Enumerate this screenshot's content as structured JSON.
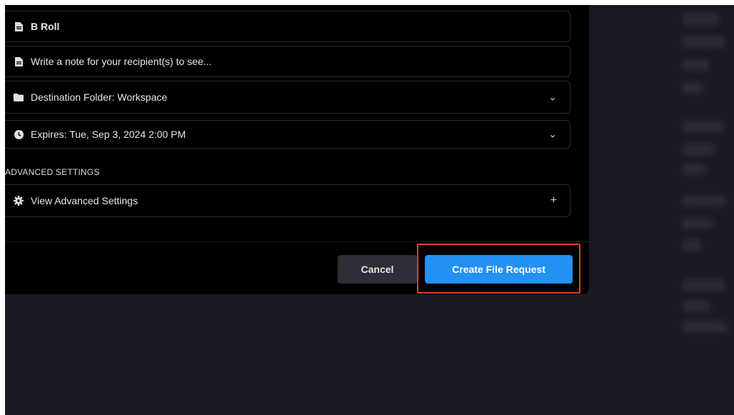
{
  "form": {
    "title_value": "B Roll",
    "note_placeholder": "Write a note for your recipient(s) to see...",
    "destination_label": "Destination Folder: Workspace",
    "expires_label": "Expires: Tue, Sep 3, 2024 2:00 PM",
    "advanced_section_title": "ADVANCED SETTINGS",
    "advanced_toggle_label": "View Advanced Settings",
    "advanced_toggle_symbol": "+",
    "chevron_symbol": "⌄"
  },
  "footer": {
    "cancel_label": "Cancel",
    "create_label": "Create File Request"
  },
  "icons": {
    "title": "file-icon",
    "note": "file-icon",
    "destination": "folder-icon",
    "expires": "clock-icon",
    "advanced": "gear-icon"
  },
  "colors": {
    "modal_background": "#000000",
    "page_background": "#1b1a24",
    "primary_button": "#2391f3",
    "secondary_button": "#2e2e36",
    "highlight_outline": "#e2402a"
  }
}
